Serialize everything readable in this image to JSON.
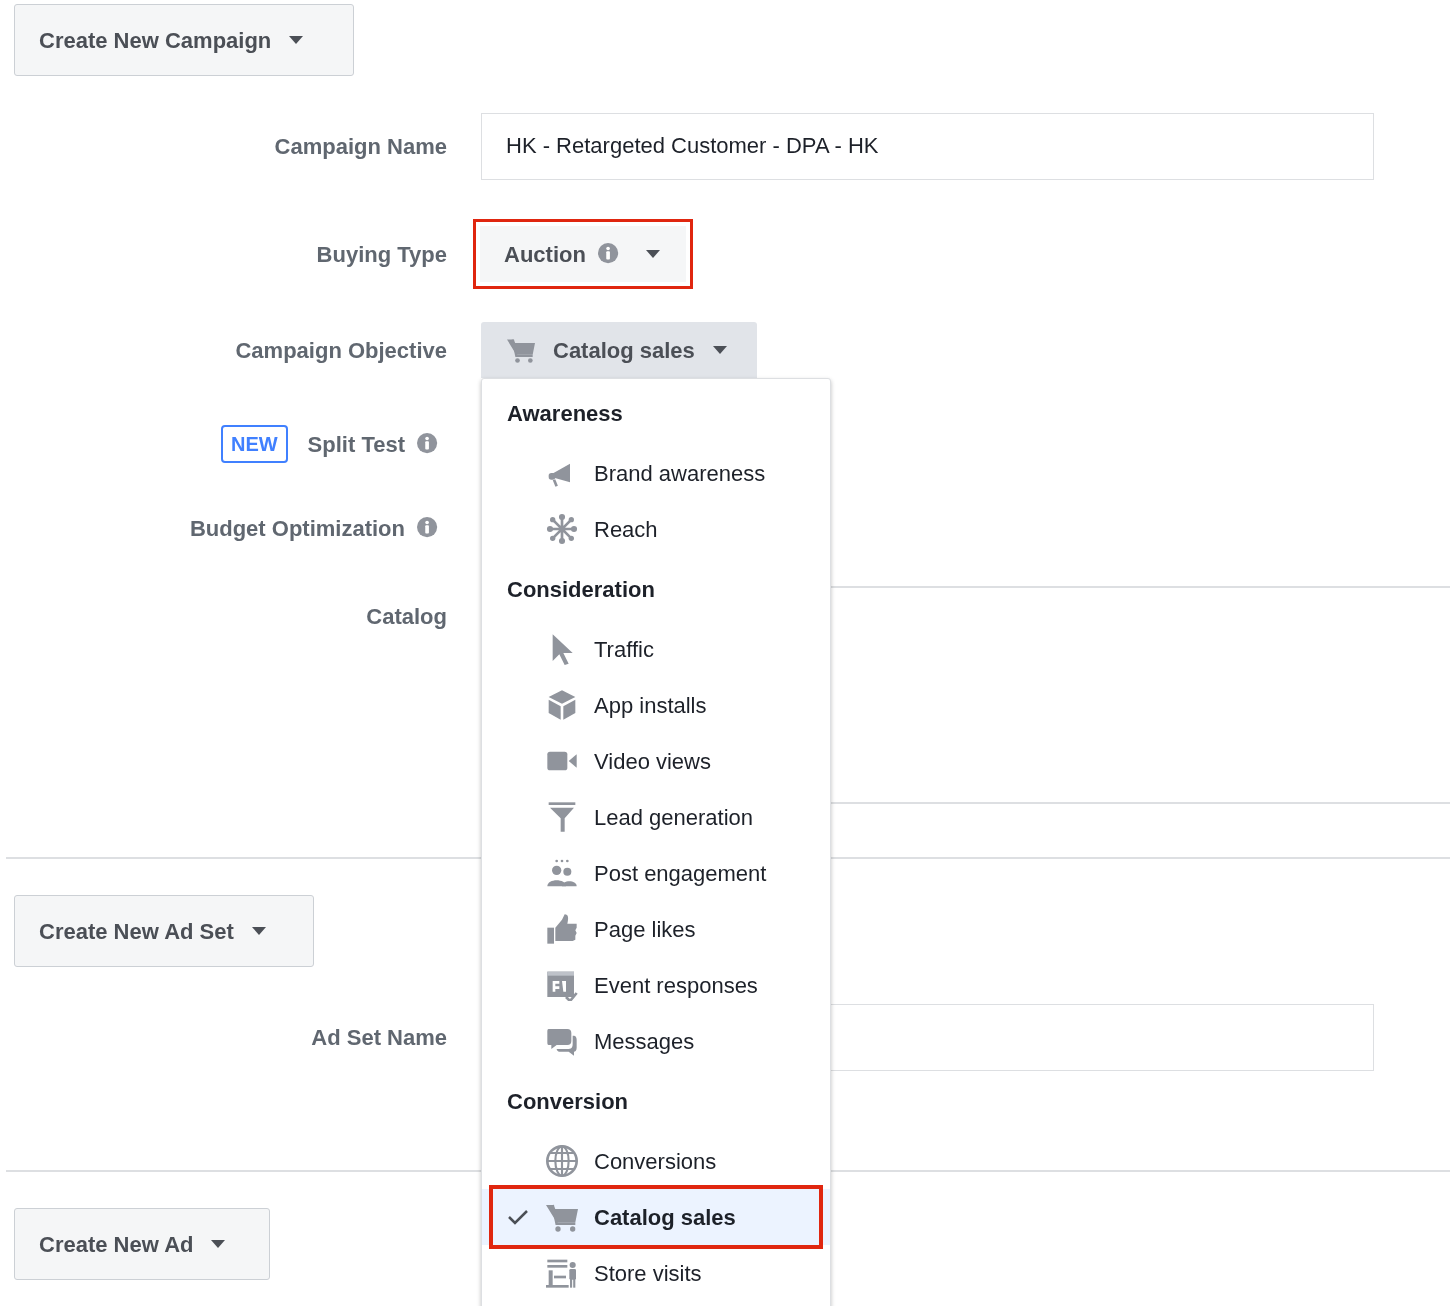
{
  "campaign": {
    "button": "Create New Campaign",
    "fields": [
      {
        "kind": "text",
        "label": "Campaign Name",
        "value": "HK - Retargeted Customer - DPA - HK"
      },
      {
        "kind": "select",
        "label": "Buying Type",
        "value": "Auction",
        "info": true,
        "highlighted": true
      },
      {
        "kind": "objective",
        "label": "Campaign Objective",
        "value": "Catalog sales",
        "expanded": true
      },
      {
        "kind": "setting",
        "label": "Split Test",
        "badge": "NEW",
        "info": true
      },
      {
        "kind": "setting",
        "label": "Budget Optimization",
        "info": true
      },
      {
        "kind": "panel",
        "label": "Catalog"
      }
    ]
  },
  "objective_menu": {
    "groups": [
      {
        "heading": "Awareness",
        "items": [
          {
            "kind": "megaphone",
            "label": "Brand awareness",
            "selected": false
          },
          {
            "kind": "reach",
            "label": "Reach",
            "selected": false
          }
        ]
      },
      {
        "heading": "Consideration",
        "items": [
          {
            "kind": "cursor",
            "label": "Traffic",
            "selected": false
          },
          {
            "kind": "cube",
            "label": "App installs",
            "selected": false
          },
          {
            "kind": "camera",
            "label": "Video views",
            "selected": false
          },
          {
            "kind": "funnel",
            "label": "Lead generation",
            "selected": false
          },
          {
            "kind": "people",
            "label": "Post engagement",
            "selected": false
          },
          {
            "kind": "thumb",
            "label": "Page likes",
            "selected": false
          },
          {
            "kind": "calendar",
            "label": "Event responses",
            "selected": false
          },
          {
            "kind": "chat",
            "label": "Messages",
            "selected": false
          }
        ]
      },
      {
        "heading": "Conversion",
        "items": [
          {
            "kind": "globe",
            "label": "Conversions",
            "selected": false
          },
          {
            "kind": "cart",
            "label": "Catalog sales",
            "selected": true,
            "highlighted": true
          },
          {
            "kind": "store",
            "label": "Store visits",
            "selected": false
          }
        ]
      }
    ]
  },
  "ad_set": {
    "button": "Create New Ad Set",
    "fields": [
      {
        "kind": "text",
        "label": "Ad Set Name"
      }
    ]
  },
  "ad": {
    "button": "Create New Ad"
  }
}
